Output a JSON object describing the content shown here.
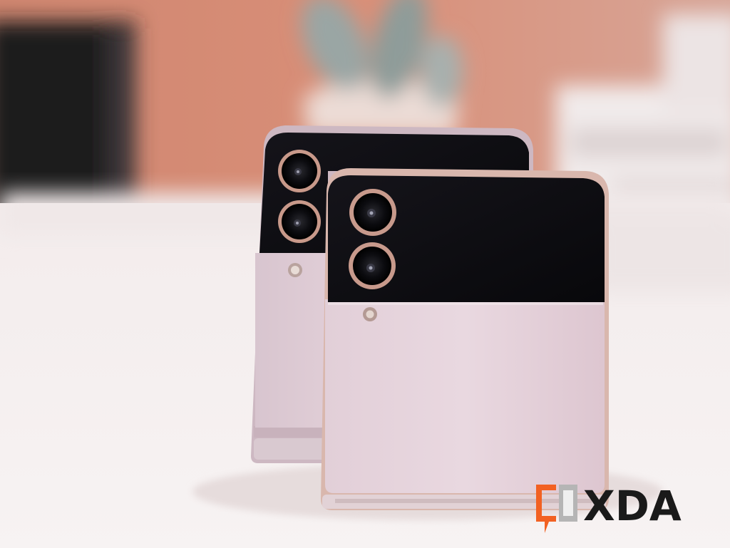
{
  "photo": {
    "subject": "",
    "colors": {
      "wall": "#d98f78",
      "table": "#f2ecec",
      "phone_body": "#e6d3dc",
      "phone_glass_black": "#0d0d12",
      "frame_metal": "#d8b7ae",
      "camera_ring": "#c89a8c"
    }
  },
  "watermark": {
    "logo_text": "XDA",
    "accent_color": "#f26122"
  }
}
